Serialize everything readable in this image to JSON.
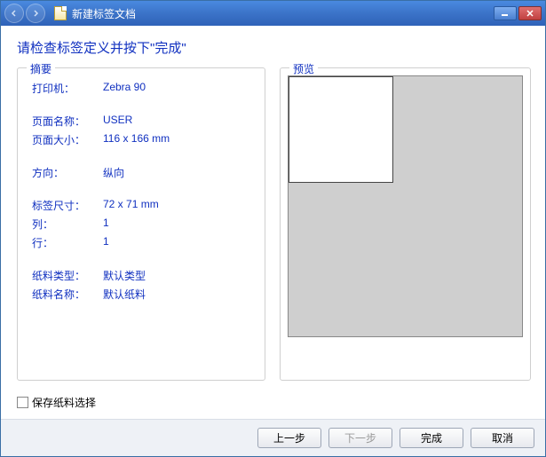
{
  "window": {
    "title": "新建标签文档"
  },
  "instruction": "请检查标签定义并按下\"完成\"",
  "summary": {
    "title": "摘要",
    "labels": {
      "printer": "打印机：",
      "page_name": "页面名称：",
      "page_size": "页面大小：",
      "orientation": "方向：",
      "label_size": "标签尺寸：",
      "columns": "列：",
      "rows": "行：",
      "stock_type": "纸料类型：",
      "stock_name": "纸料名称："
    },
    "values": {
      "printer": "Zebra 90",
      "page_name": "USER",
      "page_size": "116 x 166 mm",
      "orientation": "纵向",
      "label_size": "72 x 71 mm",
      "columns": "1",
      "rows": "1",
      "stock_type": "默认类型",
      "stock_name": "默认纸料"
    }
  },
  "preview": {
    "title": "预览"
  },
  "checkbox": {
    "save_stock": "保存纸料选择",
    "checked": false
  },
  "buttons": {
    "back": "上一步",
    "next": "下一步",
    "finish": "完成",
    "cancel": "取消"
  }
}
